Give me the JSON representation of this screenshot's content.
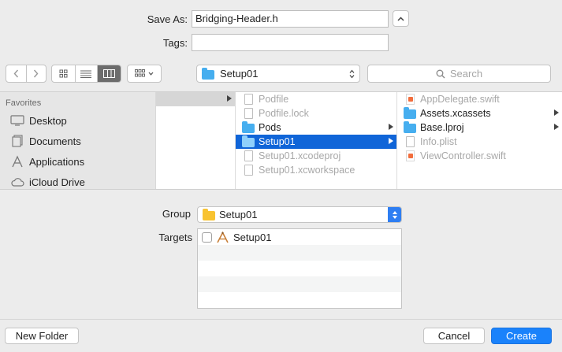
{
  "save_as": {
    "label": "Save As:",
    "value": "Bridging-Header.h"
  },
  "tags": {
    "label": "Tags:",
    "value": ""
  },
  "toolbar": {
    "location": "Setup01",
    "search_placeholder": "Search"
  },
  "sidebar": {
    "heading": "Favorites",
    "items": [
      {
        "label": "Desktop",
        "icon": "desktop-icon"
      },
      {
        "label": "Documents",
        "icon": "documents-icon"
      },
      {
        "label": "Applications",
        "icon": "applications-icon"
      },
      {
        "label": "iCloud Drive",
        "icon": "cloud-icon"
      }
    ]
  },
  "columns": {
    "col2": [
      {
        "label": "Podfile",
        "kind": "doc",
        "dim": true
      },
      {
        "label": "Podfile.lock",
        "kind": "doc",
        "dim": true
      },
      {
        "label": "Pods",
        "kind": "folder",
        "dim": false,
        "arrow": true
      },
      {
        "label": "Setup01",
        "kind": "folder",
        "dim": false,
        "selected": true,
        "arrow": true
      },
      {
        "label": "Setup01.xcodeproj",
        "kind": "doc",
        "dim": true
      },
      {
        "label": "Setup01.xcworkspace",
        "kind": "doc",
        "dim": true
      }
    ],
    "col3": [
      {
        "label": "AppDelegate.swift",
        "kind": "swift",
        "dim": true
      },
      {
        "label": "Assets.xcassets",
        "kind": "folder",
        "dim": false,
        "arrow": true
      },
      {
        "label": "Base.lproj",
        "kind": "folder",
        "dim": false,
        "arrow": true
      },
      {
        "label": "Info.plist",
        "kind": "doc",
        "dim": true
      },
      {
        "label": "ViewController.swift",
        "kind": "swift",
        "dim": true
      }
    ]
  },
  "group": {
    "label": "Group",
    "value": "Setup01"
  },
  "targets": {
    "label": "Targets",
    "items": [
      {
        "label": "Setup01",
        "checked": false
      }
    ]
  },
  "buttons": {
    "new_folder": "New Folder",
    "cancel": "Cancel",
    "create": "Create"
  }
}
